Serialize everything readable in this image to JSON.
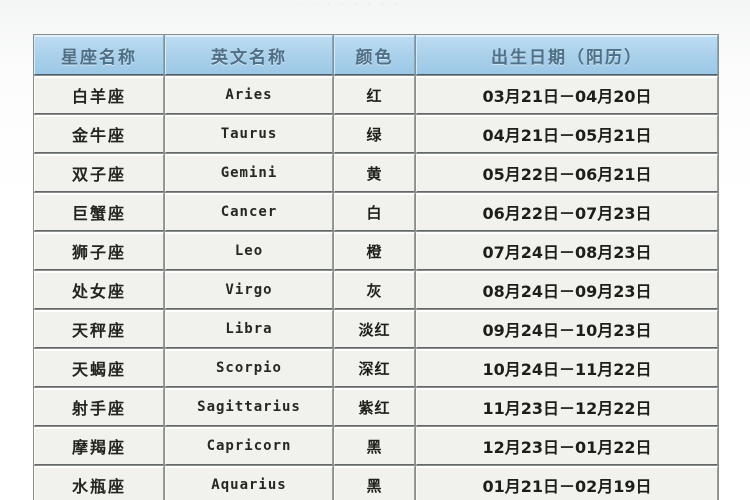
{
  "page": {
    "top_remnant": "· · · · ·   · ·    ·"
  },
  "table": {
    "columns": [
      {
        "key": "name",
        "label": "星座名称"
      },
      {
        "key": "en",
        "label": "英文名称"
      },
      {
        "key": "color",
        "label": "颜色"
      },
      {
        "key": "date",
        "label": "出生日期（阳历）"
      }
    ],
    "rows": [
      {
        "name": "白羊座",
        "en": "Aries",
        "color": "红",
        "date": "03月21日－04月20日"
      },
      {
        "name": "金牛座",
        "en": "Taurus",
        "color": "绿",
        "date": "04月21日－05月21日"
      },
      {
        "name": "双子座",
        "en": "Gemini",
        "color": "黄",
        "date": "05月22日－06月21日"
      },
      {
        "name": "巨蟹座",
        "en": "Cancer",
        "color": "白",
        "date": "06月22日－07月23日"
      },
      {
        "name": "狮子座",
        "en": "Leo",
        "color": "橙",
        "date": "07月24日－08月23日"
      },
      {
        "name": "处女座",
        "en": "Virgo",
        "color": "灰",
        "date": "08月24日－09月23日"
      },
      {
        "name": "天秤座",
        "en": "Libra",
        "color": "淡红",
        "date": "09月24日－10月23日"
      },
      {
        "name": "天蝎座",
        "en": "Scorpio",
        "color": "深红",
        "date": "10月24日－11月22日"
      },
      {
        "name": "射手座",
        "en": "Sagittarius",
        "color": "紫红",
        "date": "11月23日－12月22日"
      },
      {
        "name": "摩羯座",
        "en": "Capricorn",
        "color": "黑",
        "date": "12月23日－01月22日"
      },
      {
        "name": "水瓶座",
        "en": "Aquarius",
        "color": "黑",
        "date": "01月21日－02月19日"
      }
    ]
  },
  "colors": {
    "header_bg": "#a9d0ea",
    "header_text": "#4e6f86",
    "cell_bg": "#f1f2ee",
    "cell_text": "#23241f",
    "grid_line": "#63676a",
    "page_bg": "#ffffff"
  }
}
